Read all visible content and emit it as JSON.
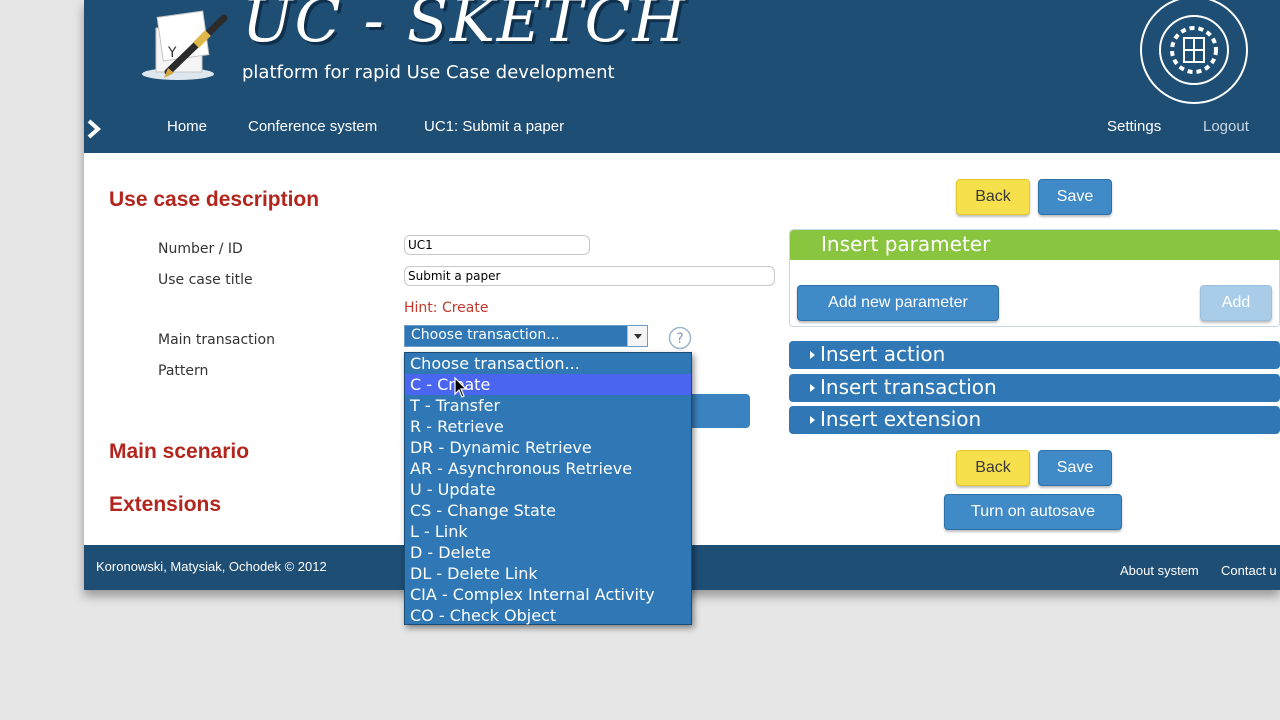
{
  "header": {
    "logo_title": "UC - SKETCH",
    "logo_subtitle": "platform for rapid Use Case development",
    "seal_text": "POLITECHNIKA POZNAŃSKA"
  },
  "nav": {
    "home": "Home",
    "breadcrumb_parent": "Conference system",
    "breadcrumb_current": "UC1: Submit a paper",
    "settings": "Settings",
    "logout": "Logout"
  },
  "form": {
    "section_title": "Use case description",
    "number_label": "Number / ID",
    "number_value": "UC1",
    "title_label": "Use case title",
    "title_value": "Submit a paper",
    "hint": "Hint: Create",
    "main_transaction_label": "Main transaction",
    "main_transaction_value": "Choose transaction...",
    "pattern_label": "Pattern"
  },
  "sections": {
    "main_scenario": "Main scenario",
    "extensions": "Extensions"
  },
  "actions": {
    "back": "Back",
    "save": "Save",
    "autosave": "Turn on autosave"
  },
  "right_panel": {
    "insert_parameter": "Insert parameter",
    "add_new_parameter": "Add new parameter",
    "add": "Add",
    "insert_action": "Insert action",
    "insert_transaction": "Insert transaction",
    "insert_extension": "Insert extension"
  },
  "dropdown": {
    "selected_index": 1,
    "options": [
      "Choose transaction...",
      "C - Create",
      "T - Transfer",
      "R - Retrieve",
      "DR - Dynamic Retrieve",
      "AR - Asynchronous Retrieve",
      "U - Update",
      "CS - Change State",
      "L - Link",
      "D - Delete",
      "DL - Delete Link",
      "CIA - Complex Internal Activity",
      "CO - Check Object"
    ]
  },
  "footer": {
    "copyright": "Koronowski, Matysiak, Ochodek © 2012",
    "about": "About system",
    "contact": "Contact u"
  },
  "colors": {
    "header_bg": "#1f4e75",
    "accent_blue": "#2f78b5",
    "accent_green": "#8ac53f",
    "accent_yellow": "#f6e04b",
    "title_red": "#b3261e"
  }
}
